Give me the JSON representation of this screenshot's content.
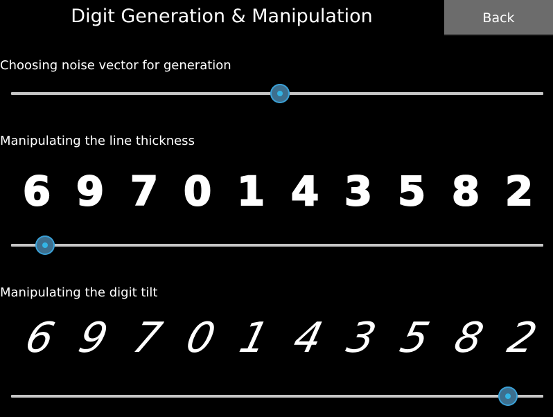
{
  "header": {
    "title": "Digit Generation & Manipulation",
    "back_label": "Back"
  },
  "sections": {
    "noise": {
      "label": "Choosing noise vector for generation",
      "slider_value": 0.505
    },
    "thickness": {
      "label": "Manipulating the line thickness",
      "slider_value": 0.064,
      "digits": [
        "6",
        "9",
        "7",
        "0",
        "1",
        "4",
        "3",
        "5",
        "8",
        "2"
      ]
    },
    "tilt": {
      "label": "Manipulating the digit tilt",
      "slider_value": 0.933,
      "digits": [
        "6",
        "9",
        "7",
        "0",
        "1",
        "4",
        "3",
        "5",
        "8",
        "2"
      ]
    }
  },
  "colors": {
    "background": "#000000",
    "track": "#c6c6c6",
    "thumb_accent": "#33b5e5",
    "back_button": "#6c6c6c"
  }
}
